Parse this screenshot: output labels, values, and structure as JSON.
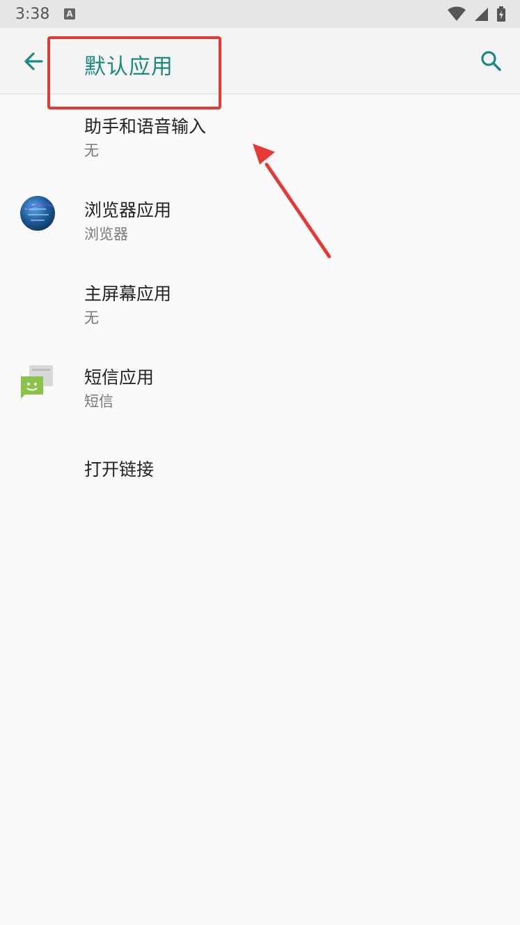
{
  "status_bar": {
    "time": "3:38",
    "notification_icon": "A",
    "icons": [
      "wifi-icon",
      "signal-icon",
      "battery-icon"
    ]
  },
  "app_bar": {
    "title": "默认应用",
    "back_icon": "arrow-left-icon",
    "search_icon": "search-icon"
  },
  "items": [
    {
      "title": "助手和语音输入",
      "subtitle": "无",
      "icon": null
    },
    {
      "title": "浏览器应用",
      "subtitle": "浏览器",
      "icon": "globe-icon"
    },
    {
      "title": "主屏幕应用",
      "subtitle": "无",
      "icon": null
    },
    {
      "title": "短信应用",
      "subtitle": "短信",
      "icon": "sms-icon"
    },
    {
      "title": "打开链接",
      "icon": null
    }
  ],
  "colors": {
    "accent": "#1a8a80",
    "annotation": "#e53935",
    "background": "#fafafa"
  }
}
